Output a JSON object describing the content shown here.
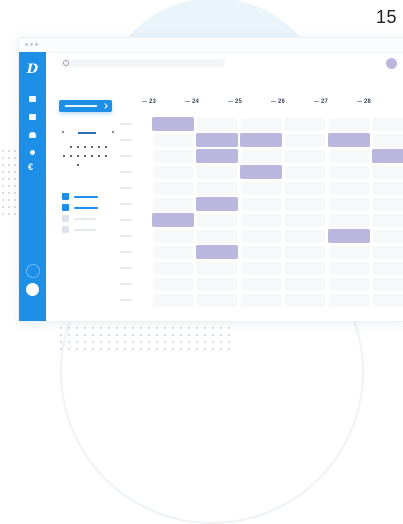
{
  "page_number": "15",
  "colors": {
    "accent": "#1d8fe6",
    "event": "#b9b7de",
    "cell": "#f6f8fa",
    "backdrop": "#eaf4fb"
  },
  "sidebar": {
    "logo_icon": "logo-d-icon",
    "items": [
      {
        "name": "sidebar-item-calendar",
        "icon": "square-icon"
      },
      {
        "name": "sidebar-item-video",
        "icon": "video-icon"
      },
      {
        "name": "sidebar-item-home",
        "icon": "home-icon"
      },
      {
        "name": "sidebar-item-alerts",
        "icon": "bell-icon"
      },
      {
        "name": "sidebar-item-billing",
        "icon": "euro-icon"
      }
    ],
    "euro_glyph": "€"
  },
  "calendar": {
    "days": [
      "23",
      "24",
      "25",
      "26",
      "27",
      "28"
    ]
  }
}
